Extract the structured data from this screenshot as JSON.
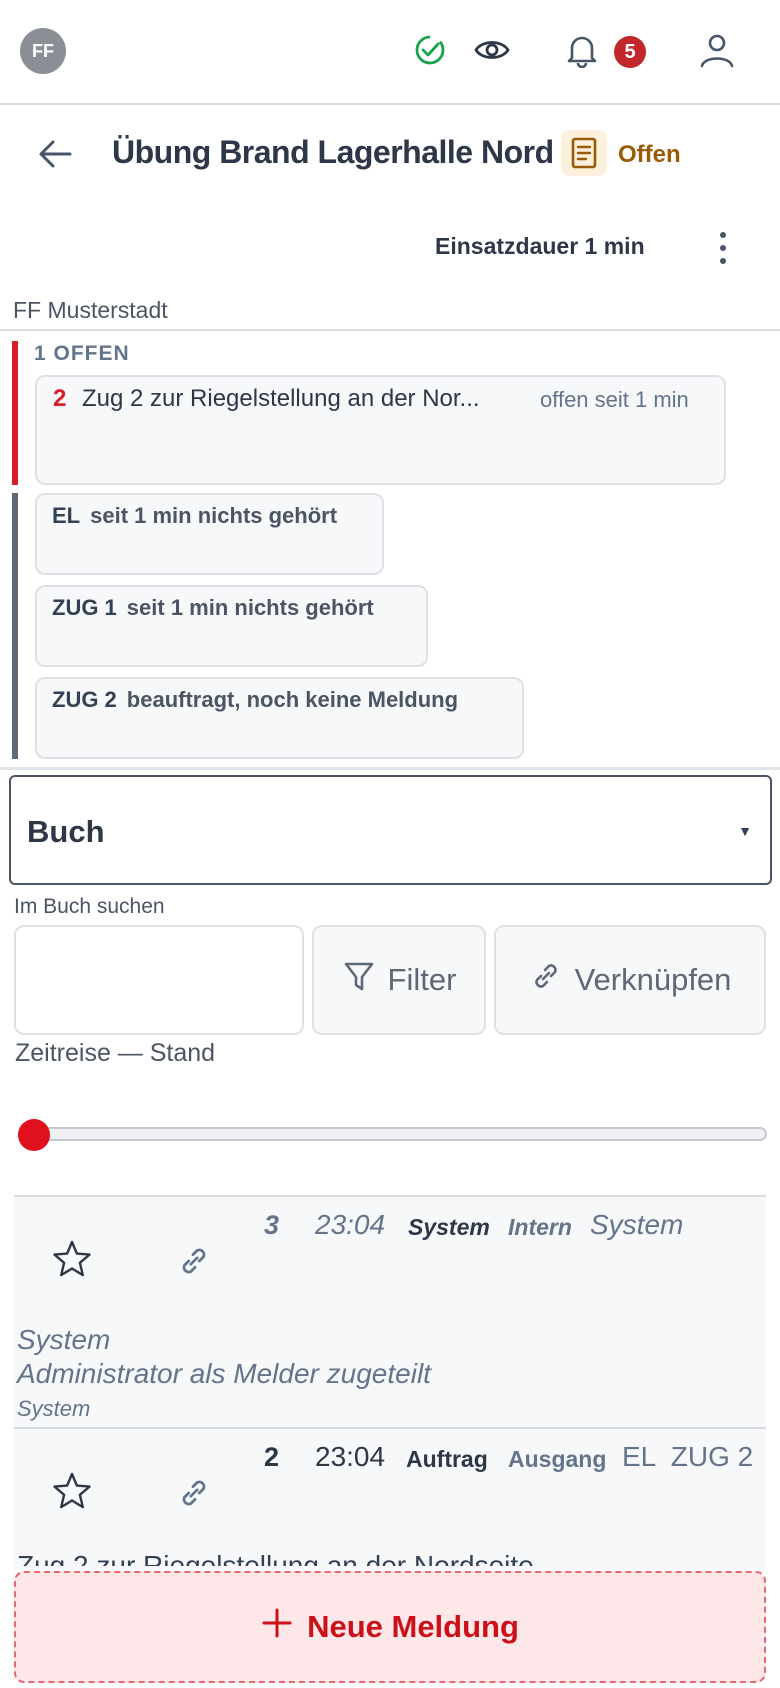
{
  "topbar": {
    "avatar_initials": "FF",
    "notification_count": "5",
    "icons": [
      "check-circle-icon",
      "eye-icon",
      "bell-icon",
      "user-icon"
    ]
  },
  "header": {
    "title": "Übung Brand Lagerhalle Nord",
    "status": "Offen",
    "duration": "Einsatzdauer 1 min",
    "organization": "FF Musterstadt"
  },
  "open_tasks": {
    "label": "1 OFFEN",
    "items": [
      {
        "number": "2",
        "text": "Zug 2 zur Riegelstellung an der Nor...",
        "since": "offen seit 1 min"
      }
    ]
  },
  "units": [
    {
      "name": "EL",
      "status": "seit 1 min nichts gehört"
    },
    {
      "name": "ZUG 1",
      "status": "seit 1 min nichts gehört"
    },
    {
      "name": "ZUG 2",
      "status": "beauftragt, noch keine Meldung"
    }
  ],
  "book": {
    "selected": "Buch",
    "search_label": "Im Buch suchen",
    "search_value": "",
    "filter_label": "Filter",
    "link_label": "Verknüpfen",
    "timetravel_label": "Zeitreise — Stand",
    "timetravel_position": 0
  },
  "entries": [
    {
      "number": "3",
      "time": "23:04",
      "type": "System",
      "direction": "Intern",
      "address": "System",
      "body_line1": "System",
      "body_line2": "Administrator als Melder zugeteilt",
      "sign": "System"
    },
    {
      "number": "2",
      "time": "23:04",
      "type": "Auftrag",
      "direction": "Ausgang",
      "address": "EL  ZUG 2",
      "body_line1": "Zug 2 zur Riegelstellung an der Nordseite"
    }
  ],
  "actions": {
    "new_message": "Neue Meldung"
  },
  "colors": {
    "accent_red": "#d61f26",
    "status_ok": "#16a34a",
    "status_open": "#9a5b06",
    "unit_bar": "#5f6877"
  }
}
